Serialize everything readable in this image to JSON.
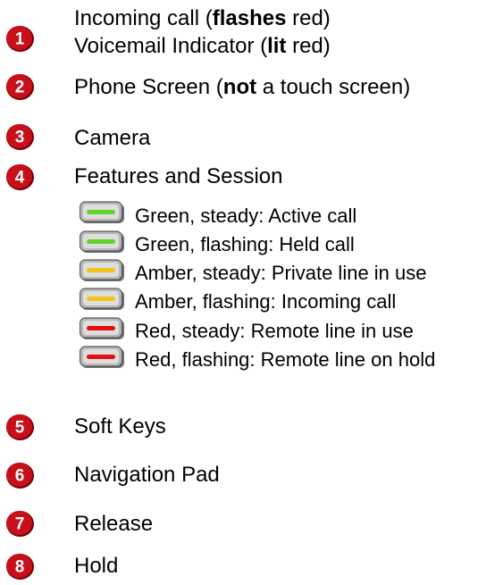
{
  "colors": {
    "badge": "#c8101b",
    "badge_dark": "#7a0008",
    "badge_text": "#ffffff",
    "led_green": "#5fd42a",
    "led_amber": "#f2c21c",
    "led_red": "#e01010"
  },
  "items": [
    {
      "number": "1",
      "lines": [
        {
          "pre": "Incoming call (",
          "bold": "flashes",
          "post": " red)"
        },
        {
          "pre": "Voicemail Indicator (",
          "bold": "lit",
          "post": " red)"
        }
      ]
    },
    {
      "number": "2",
      "lines": [
        {
          "pre": "Phone Screen (",
          "bold": "not",
          "post": " a touch screen)"
        }
      ]
    },
    {
      "number": "3",
      "lines": [
        {
          "pre": "Camera",
          "bold": "",
          "post": ""
        }
      ]
    },
    {
      "number": "4",
      "lines": [
        {
          "pre": "Features and Session",
          "bold": "",
          "post": ""
        }
      ]
    },
    {
      "number": "5",
      "lines": [
        {
          "pre": "Soft Keys",
          "bold": "",
          "post": ""
        }
      ]
    },
    {
      "number": "6",
      "lines": [
        {
          "pre": "Navigation Pad",
          "bold": "",
          "post": ""
        }
      ]
    },
    {
      "number": "7",
      "lines": [
        {
          "pre": "Release",
          "bold": "",
          "post": ""
        }
      ]
    },
    {
      "number": "8",
      "lines": [
        {
          "pre": "Hold",
          "bold": "",
          "post": ""
        }
      ]
    }
  ],
  "session_states": [
    {
      "led_color": "green",
      "text": "Green, steady: Active call"
    },
    {
      "led_color": "green",
      "text": "Green, flashing: Held call"
    },
    {
      "led_color": "amber",
      "text": "Amber, steady: Private line in use"
    },
    {
      "led_color": "amber",
      "text": "Amber, flashing: Incoming call"
    },
    {
      "led_color": "red",
      "text": "Red, steady: Remote line in use"
    },
    {
      "led_color": "red",
      "text": "Red, flashing: Remote line on hold"
    }
  ]
}
